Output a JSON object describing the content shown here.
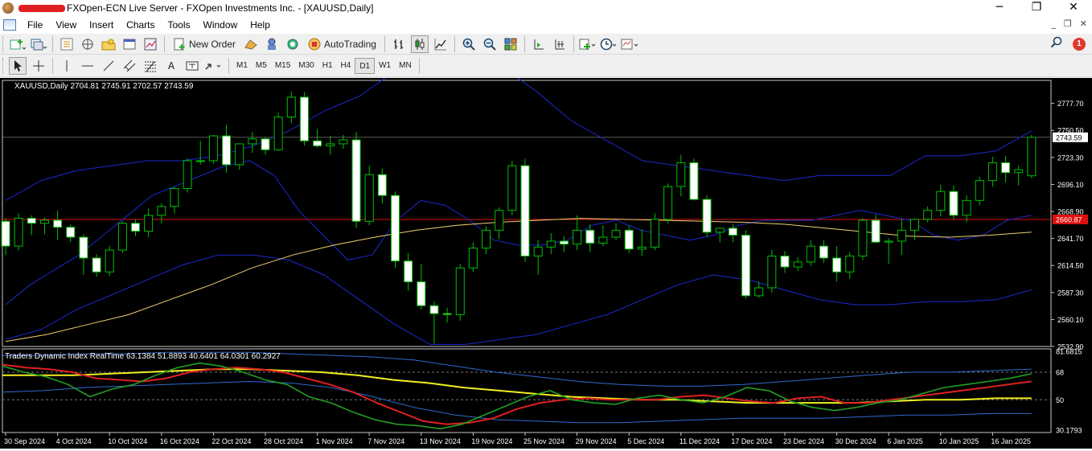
{
  "window": {
    "title": "FXOpen-ECN Live Server - FXOpen Investments Inc. - [XAUUSD,Daily]",
    "minimize": "─",
    "restore": "❐",
    "close": "✕"
  },
  "menu": [
    "File",
    "View",
    "Insert",
    "Charts",
    "Tools",
    "Window",
    "Help"
  ],
  "mdi_controls": [
    "_",
    "❐",
    "✕"
  ],
  "toolbar": {
    "new_order": "New Order",
    "autotrading": "AutoTrading",
    "notifications_count": "1"
  },
  "drawing_tools": {
    "text": "A"
  },
  "timeframes": [
    "M1",
    "M5",
    "M15",
    "M30",
    "H1",
    "H4",
    "D1",
    "W1",
    "MN"
  ],
  "active_timeframe": "D1",
  "chart": {
    "header": "XAUUSD,Daily  2704.81 2745.91 2702.57 2743.59",
    "current_price": "2743.59",
    "hline_price": "2660.87",
    "price_axis": [
      "2777.70",
      "2750.50",
      "2723.30",
      "2696.10",
      "2668.90",
      "2641.70",
      "2614.50",
      "2587.30",
      "2560.10",
      "2532.90"
    ],
    "indicator_header": "Traders Dynamic Index RealTime 63.1384 51.8893 40.6401 64.0301 60.2927",
    "indicator_axis": [
      "81.6815",
      "68",
      "50",
      "30.1793"
    ],
    "date_axis": [
      "30 Sep 2024",
      "4 Oct 2024",
      "10 Oct 2024",
      "16 Oct 2024",
      "22 Oct 2024",
      "28 Oct 2024",
      "1 Nov 2024",
      "7 Nov 2024",
      "13 Nov 2024",
      "19 Nov 2024",
      "25 Nov 2024",
      "29 Nov 2024",
      "5 Dec 2024",
      "11 Dec 2024",
      "17 Dec 2024",
      "23 Dec 2024",
      "30 Dec 2024",
      "6 Jan 2025",
      "10 Jan 2025",
      "16 Jan 2025"
    ]
  },
  "colors": {
    "bull_candle": "#000000",
    "bear_candle": "#ffffff",
    "candle_outline": "#00c000",
    "bollinger": "#1a2ad0",
    "ma": "#f0d070",
    "hline": "#e01010",
    "tdi_volatility": "#2f6bd0",
    "tdi_rsi": "#22a022",
    "tdi_signal": "#e02020",
    "tdi_mbl": "#f0f020"
  },
  "chart_data": {
    "type": "candlestick",
    "symbol": "XAUUSD",
    "timeframe": "Daily",
    "ylim": [
      2532.9,
      2800.9
    ],
    "dates": [
      "2024-09-30",
      "2024-10-01",
      "2024-10-02",
      "2024-10-03",
      "2024-10-04",
      "2024-10-07",
      "2024-10-08",
      "2024-10-09",
      "2024-10-10",
      "2024-10-11",
      "2024-10-14",
      "2024-10-15",
      "2024-10-16",
      "2024-10-17",
      "2024-10-18",
      "2024-10-21",
      "2024-10-22",
      "2024-10-23",
      "2024-10-24",
      "2024-10-25",
      "2024-10-28",
      "2024-10-29",
      "2024-10-30",
      "2024-10-31",
      "2024-11-01",
      "2024-11-04",
      "2024-11-05",
      "2024-11-06",
      "2024-11-07",
      "2024-11-08",
      "2024-11-11",
      "2024-11-12",
      "2024-11-13",
      "2024-11-14",
      "2024-11-15",
      "2024-11-18",
      "2024-11-19",
      "2024-11-20",
      "2024-11-21",
      "2024-11-22",
      "2024-11-25",
      "2024-11-26",
      "2024-11-27",
      "2024-11-28",
      "2024-11-29",
      "2024-12-02",
      "2024-12-03",
      "2024-12-04",
      "2024-12-05",
      "2024-12-06",
      "2024-12-09",
      "2024-12-10",
      "2024-12-11",
      "2024-12-12",
      "2024-12-13",
      "2024-12-16",
      "2024-12-17",
      "2024-12-18",
      "2024-12-19",
      "2024-12-20",
      "2024-12-23",
      "2024-12-24",
      "2024-12-25",
      "2024-12-26",
      "2024-12-27",
      "2024-12-30",
      "2024-12-31",
      "2025-01-02",
      "2025-01-03",
      "2025-01-06",
      "2025-01-07",
      "2025-01-08",
      "2025-01-09",
      "2025-01-10",
      "2025-01-13",
      "2025-01-14",
      "2025-01-15",
      "2025-01-16",
      "2025-01-17",
      "2025-01-20"
    ],
    "ohlc": [
      [
        2659,
        2662,
        2625,
        2634
      ],
      [
        2634,
        2667,
        2630,
        2662
      ],
      [
        2662,
        2665,
        2645,
        2657
      ],
      [
        2657,
        2663,
        2646,
        2660
      ],
      [
        2660,
        2670,
        2640,
        2653
      ],
      [
        2653,
        2656,
        2638,
        2643
      ],
      [
        2643,
        2646,
        2605,
        2622
      ],
      [
        2622,
        2626,
        2603,
        2608
      ],
      [
        2608,
        2634,
        2604,
        2630
      ],
      [
        2630,
        2659,
        2627,
        2657
      ],
      [
        2657,
        2661,
        2644,
        2649
      ],
      [
        2649,
        2672,
        2643,
        2665
      ],
      [
        2665,
        2677,
        2657,
        2674
      ],
      [
        2674,
        2694,
        2667,
        2692
      ],
      [
        2692,
        2722,
        2688,
        2720
      ],
      [
        2720,
        2740,
        2716,
        2720
      ],
      [
        2720,
        2746,
        2717,
        2745
      ],
      [
        2745,
        2756,
        2708,
        2716
      ],
      [
        2716,
        2737,
        2711,
        2737
      ],
      [
        2737,
        2749,
        2728,
        2742
      ],
      [
        2742,
        2744,
        2726,
        2731
      ],
      [
        2731,
        2768,
        2730,
        2764
      ],
      [
        2764,
        2790,
        2758,
        2784
      ],
      [
        2784,
        2789,
        2735,
        2740
      ],
      [
        2740,
        2752,
        2733,
        2735
      ],
      [
        2735,
        2745,
        2726,
        2737
      ],
      [
        2737,
        2746,
        2732,
        2741
      ],
      [
        2741,
        2749,
        2652,
        2659
      ],
      [
        2659,
        2715,
        2655,
        2706
      ],
      [
        2706,
        2712,
        2677,
        2685
      ],
      [
        2685,
        2689,
        2612,
        2619
      ],
      [
        2619,
        2627,
        2589,
        2598
      ],
      [
        2598,
        2616,
        2570,
        2574
      ],
      [
        2574,
        2578,
        2536,
        2566
      ],
      [
        2566,
        2572,
        2557,
        2565
      ],
      [
        2565,
        2616,
        2559,
        2612
      ],
      [
        2612,
        2638,
        2608,
        2632
      ],
      [
        2632,
        2654,
        2626,
        2650
      ],
      [
        2650,
        2673,
        2641,
        2670
      ],
      [
        2670,
        2720,
        2665,
        2715
      ],
      [
        2715,
        2722,
        2618,
        2624
      ],
      [
        2624,
        2640,
        2605,
        2633
      ],
      [
        2633,
        2647,
        2626,
        2639
      ],
      [
        2639,
        2644,
        2628,
        2636
      ],
      [
        2636,
        2665,
        2630,
        2650
      ],
      [
        2650,
        2656,
        2628,
        2637
      ],
      [
        2637,
        2655,
        2634,
        2643
      ],
      [
        2643,
        2657,
        2640,
        2650
      ],
      [
        2650,
        2655,
        2627,
        2631
      ],
      [
        2631,
        2651,
        2624,
        2633
      ],
      [
        2633,
        2667,
        2630,
        2661
      ],
      [
        2661,
        2697,
        2657,
        2694
      ],
      [
        2694,
        2726,
        2684,
        2718
      ],
      [
        2718,
        2722,
        2680,
        2681
      ],
      [
        2681,
        2685,
        2643,
        2648
      ],
      [
        2648,
        2653,
        2638,
        2652
      ],
      [
        2652,
        2656,
        2638,
        2645
      ],
      [
        2645,
        2650,
        2581,
        2584
      ],
      [
        2584,
        2598,
        2582,
        2592
      ],
      [
        2592,
        2630,
        2587,
        2624
      ],
      [
        2624,
        2629,
        2607,
        2613
      ],
      [
        2613,
        2623,
        2609,
        2618
      ],
      [
        2618,
        2640,
        2614,
        2634
      ],
      [
        2634,
        2640,
        2617,
        2622
      ],
      [
        2622,
        2634,
        2598,
        2608
      ],
      [
        2608,
        2628,
        2601,
        2624
      ],
      [
        2624,
        2662,
        2620,
        2660
      ],
      [
        2660,
        2666,
        2637,
        2638
      ],
      [
        2638,
        2642,
        2616,
        2639
      ],
      [
        2639,
        2661,
        2625,
        2650
      ],
      [
        2650,
        2662,
        2640,
        2661
      ],
      [
        2661,
        2674,
        2658,
        2670
      ],
      [
        2670,
        2696,
        2664,
        2689
      ],
      [
        2689,
        2695,
        2661,
        2665
      ],
      [
        2665,
        2685,
        2658,
        2680
      ],
      [
        2680,
        2704,
        2675,
        2700
      ],
      [
        2700,
        2724,
        2694,
        2718
      ],
      [
        2718,
        2725,
        2698,
        2708
      ],
      [
        2708,
        2715,
        2695,
        2711
      ],
      [
        2704.81,
        2745.91,
        2702.57,
        2743.59
      ]
    ],
    "overlays": {
      "bollinger_upper": [
        2680,
        2700,
        2710,
        2715,
        2720,
        2720,
        2725,
        2735,
        2750,
        2770,
        2785,
        2810,
        2820,
        2820,
        2815,
        2790,
        2760,
        2740,
        2720,
        2715,
        2710,
        2705,
        2700,
        2705,
        2705,
        2705,
        2725,
        2725,
        2730,
        2750
      ],
      "bollinger_middle": [
        2575,
        2595,
        2610,
        2625,
        2645,
        2665,
        2685,
        2695,
        2705,
        2715,
        2720,
        2705,
        2670,
        2645,
        2620,
        2625,
        2660,
        2680,
        2675,
        2660,
        2640,
        2635,
        2635,
        2640,
        2655,
        2660,
        2650,
        2645,
        2640,
        2645,
        2655,
        2660,
        2660,
        2660,
        2665,
        2670,
        2665,
        2660,
        2645,
        2640,
        2645,
        2660,
        2665
      ],
      "bollinger_lower": [
        2540,
        2550,
        2570,
        2585,
        2600,
        2615,
        2625,
        2625,
        2620,
        2605,
        2580,
        2555,
        2535,
        2535,
        2540,
        2545,
        2555,
        2565,
        2580,
        2595,
        2605,
        2600,
        2590,
        2580,
        2575,
        2575,
        2578,
        2578,
        2580,
        2590
      ],
      "ma": [
        2538,
        2545,
        2555,
        2565,
        2580,
        2595,
        2612,
        2625,
        2635,
        2643,
        2650,
        2655,
        2658,
        2660,
        2662,
        2661,
        2660,
        2659,
        2658,
        2656,
        2652,
        2648,
        2644,
        2643,
        2645,
        2648
      ],
      "hline": 2660.87
    },
    "indicator": {
      "name": "Traders Dynamic Index RealTime",
      "ylim": [
        30.1793,
        81.6815
      ],
      "levels": [
        68,
        50
      ],
      "values": [
        63.1384,
        51.8893,
        40.6401,
        64.0301,
        60.2927
      ],
      "rsi": [
        72,
        68,
        65,
        60,
        52,
        57,
        60,
        66,
        71,
        74,
        72,
        68,
        63,
        60,
        52,
        48,
        42,
        37,
        34,
        33,
        31,
        34,
        40,
        46,
        52,
        56,
        50,
        48,
        47,
        51,
        53,
        50,
        48,
        52,
        58,
        56,
        49,
        45,
        43,
        45,
        48,
        50,
        54,
        58,
        60,
        62,
        64,
        67
      ],
      "signal": [
        73,
        71,
        70,
        68,
        64,
        63,
        62,
        64,
        68,
        70,
        71,
        70,
        68,
        64,
        60,
        55,
        48,
        42,
        36,
        34,
        35,
        38,
        44,
        48,
        50,
        51,
        50,
        50,
        50,
        52,
        53,
        51,
        49,
        48,
        51,
        52,
        48,
        48,
        50,
        52,
        54,
        56,
        58,
        60,
        62
      ],
      "mbl": [
        66,
        66,
        66,
        67,
        68,
        69,
        70,
        70,
        69,
        68,
        66,
        63,
        61,
        58,
        56,
        54,
        52,
        51,
        50,
        50,
        49,
        48,
        48,
        48,
        48,
        49,
        50,
        50,
        51,
        51
      ],
      "vb_upper": [
        79,
        79,
        80,
        80,
        81,
        81,
        81,
        80,
        79,
        78,
        76,
        72,
        68,
        65,
        62,
        60,
        59,
        59,
        60,
        62,
        64,
        66,
        68,
        68,
        69,
        70
      ],
      "vb_lower": [
        55,
        56,
        58,
        59,
        60,
        61,
        62,
        61,
        58,
        52,
        45,
        40,
        37,
        36,
        35,
        35,
        36,
        37,
        38,
        38,
        38,
        39,
        40,
        40,
        41,
        41
      ]
    }
  }
}
